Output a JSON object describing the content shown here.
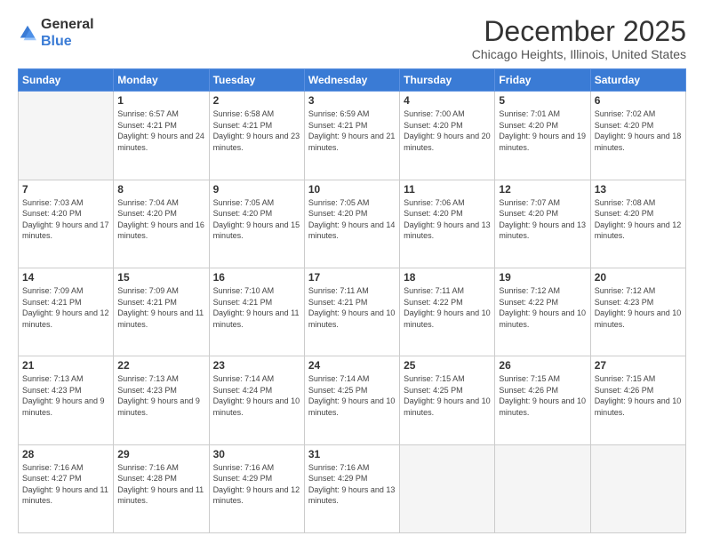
{
  "header": {
    "logo_general": "General",
    "logo_blue": "Blue",
    "month_title": "December 2025",
    "location": "Chicago Heights, Illinois, United States"
  },
  "days_of_week": [
    "Sunday",
    "Monday",
    "Tuesday",
    "Wednesday",
    "Thursday",
    "Friday",
    "Saturday"
  ],
  "weeks": [
    [
      {
        "day": "",
        "sunrise": "",
        "sunset": "",
        "daylight": "",
        "empty": true
      },
      {
        "day": "1",
        "sunrise": "Sunrise: 6:57 AM",
        "sunset": "Sunset: 4:21 PM",
        "daylight": "Daylight: 9 hours and 24 minutes."
      },
      {
        "day": "2",
        "sunrise": "Sunrise: 6:58 AM",
        "sunset": "Sunset: 4:21 PM",
        "daylight": "Daylight: 9 hours and 23 minutes."
      },
      {
        "day": "3",
        "sunrise": "Sunrise: 6:59 AM",
        "sunset": "Sunset: 4:21 PM",
        "daylight": "Daylight: 9 hours and 21 minutes."
      },
      {
        "day": "4",
        "sunrise": "Sunrise: 7:00 AM",
        "sunset": "Sunset: 4:20 PM",
        "daylight": "Daylight: 9 hours and 20 minutes."
      },
      {
        "day": "5",
        "sunrise": "Sunrise: 7:01 AM",
        "sunset": "Sunset: 4:20 PM",
        "daylight": "Daylight: 9 hours and 19 minutes."
      },
      {
        "day": "6",
        "sunrise": "Sunrise: 7:02 AM",
        "sunset": "Sunset: 4:20 PM",
        "daylight": "Daylight: 9 hours and 18 minutes."
      }
    ],
    [
      {
        "day": "7",
        "sunrise": "Sunrise: 7:03 AM",
        "sunset": "Sunset: 4:20 PM",
        "daylight": "Daylight: 9 hours and 17 minutes."
      },
      {
        "day": "8",
        "sunrise": "Sunrise: 7:04 AM",
        "sunset": "Sunset: 4:20 PM",
        "daylight": "Daylight: 9 hours and 16 minutes."
      },
      {
        "day": "9",
        "sunrise": "Sunrise: 7:05 AM",
        "sunset": "Sunset: 4:20 PM",
        "daylight": "Daylight: 9 hours and 15 minutes."
      },
      {
        "day": "10",
        "sunrise": "Sunrise: 7:05 AM",
        "sunset": "Sunset: 4:20 PM",
        "daylight": "Daylight: 9 hours and 14 minutes."
      },
      {
        "day": "11",
        "sunrise": "Sunrise: 7:06 AM",
        "sunset": "Sunset: 4:20 PM",
        "daylight": "Daylight: 9 hours and 13 minutes."
      },
      {
        "day": "12",
        "sunrise": "Sunrise: 7:07 AM",
        "sunset": "Sunset: 4:20 PM",
        "daylight": "Daylight: 9 hours and 13 minutes."
      },
      {
        "day": "13",
        "sunrise": "Sunrise: 7:08 AM",
        "sunset": "Sunset: 4:20 PM",
        "daylight": "Daylight: 9 hours and 12 minutes."
      }
    ],
    [
      {
        "day": "14",
        "sunrise": "Sunrise: 7:09 AM",
        "sunset": "Sunset: 4:21 PM",
        "daylight": "Daylight: 9 hours and 12 minutes."
      },
      {
        "day": "15",
        "sunrise": "Sunrise: 7:09 AM",
        "sunset": "Sunset: 4:21 PM",
        "daylight": "Daylight: 9 hours and 11 minutes."
      },
      {
        "day": "16",
        "sunrise": "Sunrise: 7:10 AM",
        "sunset": "Sunset: 4:21 PM",
        "daylight": "Daylight: 9 hours and 11 minutes."
      },
      {
        "day": "17",
        "sunrise": "Sunrise: 7:11 AM",
        "sunset": "Sunset: 4:21 PM",
        "daylight": "Daylight: 9 hours and 10 minutes."
      },
      {
        "day": "18",
        "sunrise": "Sunrise: 7:11 AM",
        "sunset": "Sunset: 4:22 PM",
        "daylight": "Daylight: 9 hours and 10 minutes."
      },
      {
        "day": "19",
        "sunrise": "Sunrise: 7:12 AM",
        "sunset": "Sunset: 4:22 PM",
        "daylight": "Daylight: 9 hours and 10 minutes."
      },
      {
        "day": "20",
        "sunrise": "Sunrise: 7:12 AM",
        "sunset": "Sunset: 4:23 PM",
        "daylight": "Daylight: 9 hours and 10 minutes."
      }
    ],
    [
      {
        "day": "21",
        "sunrise": "Sunrise: 7:13 AM",
        "sunset": "Sunset: 4:23 PM",
        "daylight": "Daylight: 9 hours and 9 minutes."
      },
      {
        "day": "22",
        "sunrise": "Sunrise: 7:13 AM",
        "sunset": "Sunset: 4:23 PM",
        "daylight": "Daylight: 9 hours and 9 minutes."
      },
      {
        "day": "23",
        "sunrise": "Sunrise: 7:14 AM",
        "sunset": "Sunset: 4:24 PM",
        "daylight": "Daylight: 9 hours and 10 minutes."
      },
      {
        "day": "24",
        "sunrise": "Sunrise: 7:14 AM",
        "sunset": "Sunset: 4:25 PM",
        "daylight": "Daylight: 9 hours and 10 minutes."
      },
      {
        "day": "25",
        "sunrise": "Sunrise: 7:15 AM",
        "sunset": "Sunset: 4:25 PM",
        "daylight": "Daylight: 9 hours and 10 minutes."
      },
      {
        "day": "26",
        "sunrise": "Sunrise: 7:15 AM",
        "sunset": "Sunset: 4:26 PM",
        "daylight": "Daylight: 9 hours and 10 minutes."
      },
      {
        "day": "27",
        "sunrise": "Sunrise: 7:15 AM",
        "sunset": "Sunset: 4:26 PM",
        "daylight": "Daylight: 9 hours and 10 minutes."
      }
    ],
    [
      {
        "day": "28",
        "sunrise": "Sunrise: 7:16 AM",
        "sunset": "Sunset: 4:27 PM",
        "daylight": "Daylight: 9 hours and 11 minutes."
      },
      {
        "day": "29",
        "sunrise": "Sunrise: 7:16 AM",
        "sunset": "Sunset: 4:28 PM",
        "daylight": "Daylight: 9 hours and 11 minutes."
      },
      {
        "day": "30",
        "sunrise": "Sunrise: 7:16 AM",
        "sunset": "Sunset: 4:29 PM",
        "daylight": "Daylight: 9 hours and 12 minutes."
      },
      {
        "day": "31",
        "sunrise": "Sunrise: 7:16 AM",
        "sunset": "Sunset: 4:29 PM",
        "daylight": "Daylight: 9 hours and 13 minutes."
      },
      {
        "day": "",
        "sunrise": "",
        "sunset": "",
        "daylight": "",
        "empty": true
      },
      {
        "day": "",
        "sunrise": "",
        "sunset": "",
        "daylight": "",
        "empty": true
      },
      {
        "day": "",
        "sunrise": "",
        "sunset": "",
        "daylight": "",
        "empty": true
      }
    ]
  ]
}
